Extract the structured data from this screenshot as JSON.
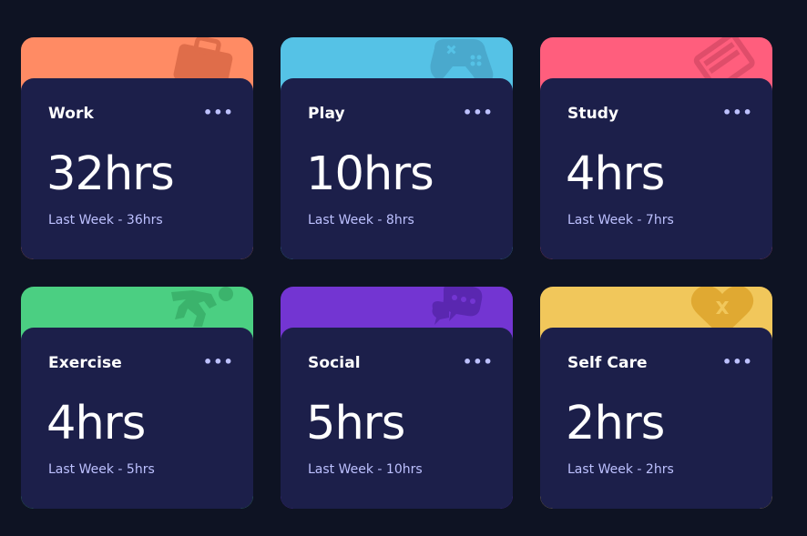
{
  "cards": [
    {
      "title": "Work",
      "current": "32hrs",
      "previous": "Last Week - 36hrs",
      "color": "#ff8b64",
      "icon": "briefcase-icon",
      "menu": "•••"
    },
    {
      "title": "Play",
      "current": "10hrs",
      "previous": "Last Week - 8hrs",
      "color": "#55c2e6",
      "icon": "gamepad-icon",
      "menu": "•••"
    },
    {
      "title": "Study",
      "current": "4hrs",
      "previous": "Last Week - 7hrs",
      "color": "#ff5e7d",
      "icon": "book-icon",
      "menu": "•••"
    },
    {
      "title": "Exercise",
      "current": "4hrs",
      "previous": "Last Week - 5hrs",
      "color": "#4bcf82",
      "icon": "running-icon",
      "menu": "•••"
    },
    {
      "title": "Social",
      "current": "5hrs",
      "previous": "Last Week - 10hrs",
      "color": "#7335d2",
      "icon": "chat-bubbles-icon",
      "menu": "•••"
    },
    {
      "title": "Self Care",
      "current": "2hrs",
      "previous": "Last Week - 2hrs",
      "color": "#f1c75b",
      "icon": "heart-icon",
      "menu": "•••"
    }
  ]
}
